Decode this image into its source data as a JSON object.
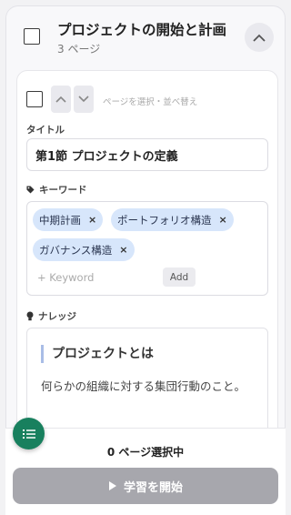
{
  "section": {
    "title": "プロジェクトの開始と計画",
    "page_count": "3 ページ"
  },
  "page": {
    "reorder_hint": "ページを選択・並べ替え",
    "title_label": "タイトル",
    "title_value": "第1節 プロジェクトの定義",
    "keywords_label": "キーワード",
    "keywords": [
      "中期計画",
      "ポートフォリオ構造",
      "ガバナンス構造"
    ],
    "keyword_remove": "×",
    "keyword_placeholder": "+ Keyword",
    "add_label": "Add",
    "knowledge_label": "ナレッジ",
    "knowledge_heading": "プロジェクトとは",
    "knowledge_body": "何らかの組織に対する集団行動のこと。"
  },
  "footer": {
    "selection_status": "0 ページ選択中",
    "start_label": "学習を開始"
  },
  "colors": {
    "accent_green": "#18805e",
    "chip_bg": "#d7e6fb",
    "disabled_button": "#a7a7ad"
  }
}
